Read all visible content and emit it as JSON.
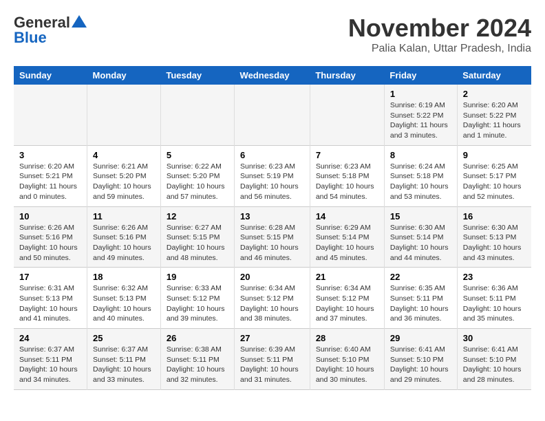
{
  "header": {
    "logo_general": "General",
    "logo_blue": "Blue",
    "month_title": "November 2024",
    "location": "Palia Kalan, Uttar Pradesh, India"
  },
  "weekdays": [
    "Sunday",
    "Monday",
    "Tuesday",
    "Wednesday",
    "Thursday",
    "Friday",
    "Saturday"
  ],
  "weeks": [
    [
      {
        "day": "",
        "info": ""
      },
      {
        "day": "",
        "info": ""
      },
      {
        "day": "",
        "info": ""
      },
      {
        "day": "",
        "info": ""
      },
      {
        "day": "",
        "info": ""
      },
      {
        "day": "1",
        "info": "Sunrise: 6:19 AM\nSunset: 5:22 PM\nDaylight: 11 hours and 3 minutes."
      },
      {
        "day": "2",
        "info": "Sunrise: 6:20 AM\nSunset: 5:22 PM\nDaylight: 11 hours and 1 minute."
      }
    ],
    [
      {
        "day": "3",
        "info": "Sunrise: 6:20 AM\nSunset: 5:21 PM\nDaylight: 11 hours and 0 minutes."
      },
      {
        "day": "4",
        "info": "Sunrise: 6:21 AM\nSunset: 5:20 PM\nDaylight: 10 hours and 59 minutes."
      },
      {
        "day": "5",
        "info": "Sunrise: 6:22 AM\nSunset: 5:20 PM\nDaylight: 10 hours and 57 minutes."
      },
      {
        "day": "6",
        "info": "Sunrise: 6:23 AM\nSunset: 5:19 PM\nDaylight: 10 hours and 56 minutes."
      },
      {
        "day": "7",
        "info": "Sunrise: 6:23 AM\nSunset: 5:18 PM\nDaylight: 10 hours and 54 minutes."
      },
      {
        "day": "8",
        "info": "Sunrise: 6:24 AM\nSunset: 5:18 PM\nDaylight: 10 hours and 53 minutes."
      },
      {
        "day": "9",
        "info": "Sunrise: 6:25 AM\nSunset: 5:17 PM\nDaylight: 10 hours and 52 minutes."
      }
    ],
    [
      {
        "day": "10",
        "info": "Sunrise: 6:26 AM\nSunset: 5:16 PM\nDaylight: 10 hours and 50 minutes."
      },
      {
        "day": "11",
        "info": "Sunrise: 6:26 AM\nSunset: 5:16 PM\nDaylight: 10 hours and 49 minutes."
      },
      {
        "day": "12",
        "info": "Sunrise: 6:27 AM\nSunset: 5:15 PM\nDaylight: 10 hours and 48 minutes."
      },
      {
        "day": "13",
        "info": "Sunrise: 6:28 AM\nSunset: 5:15 PM\nDaylight: 10 hours and 46 minutes."
      },
      {
        "day": "14",
        "info": "Sunrise: 6:29 AM\nSunset: 5:14 PM\nDaylight: 10 hours and 45 minutes."
      },
      {
        "day": "15",
        "info": "Sunrise: 6:30 AM\nSunset: 5:14 PM\nDaylight: 10 hours and 44 minutes."
      },
      {
        "day": "16",
        "info": "Sunrise: 6:30 AM\nSunset: 5:13 PM\nDaylight: 10 hours and 43 minutes."
      }
    ],
    [
      {
        "day": "17",
        "info": "Sunrise: 6:31 AM\nSunset: 5:13 PM\nDaylight: 10 hours and 41 minutes."
      },
      {
        "day": "18",
        "info": "Sunrise: 6:32 AM\nSunset: 5:13 PM\nDaylight: 10 hours and 40 minutes."
      },
      {
        "day": "19",
        "info": "Sunrise: 6:33 AM\nSunset: 5:12 PM\nDaylight: 10 hours and 39 minutes."
      },
      {
        "day": "20",
        "info": "Sunrise: 6:34 AM\nSunset: 5:12 PM\nDaylight: 10 hours and 38 minutes."
      },
      {
        "day": "21",
        "info": "Sunrise: 6:34 AM\nSunset: 5:12 PM\nDaylight: 10 hours and 37 minutes."
      },
      {
        "day": "22",
        "info": "Sunrise: 6:35 AM\nSunset: 5:11 PM\nDaylight: 10 hours and 36 minutes."
      },
      {
        "day": "23",
        "info": "Sunrise: 6:36 AM\nSunset: 5:11 PM\nDaylight: 10 hours and 35 minutes."
      }
    ],
    [
      {
        "day": "24",
        "info": "Sunrise: 6:37 AM\nSunset: 5:11 PM\nDaylight: 10 hours and 34 minutes."
      },
      {
        "day": "25",
        "info": "Sunrise: 6:37 AM\nSunset: 5:11 PM\nDaylight: 10 hours and 33 minutes."
      },
      {
        "day": "26",
        "info": "Sunrise: 6:38 AM\nSunset: 5:11 PM\nDaylight: 10 hours and 32 minutes."
      },
      {
        "day": "27",
        "info": "Sunrise: 6:39 AM\nSunset: 5:11 PM\nDaylight: 10 hours and 31 minutes."
      },
      {
        "day": "28",
        "info": "Sunrise: 6:40 AM\nSunset: 5:10 PM\nDaylight: 10 hours and 30 minutes."
      },
      {
        "day": "29",
        "info": "Sunrise: 6:41 AM\nSunset: 5:10 PM\nDaylight: 10 hours and 29 minutes."
      },
      {
        "day": "30",
        "info": "Sunrise: 6:41 AM\nSunset: 5:10 PM\nDaylight: 10 hours and 28 minutes."
      }
    ]
  ]
}
